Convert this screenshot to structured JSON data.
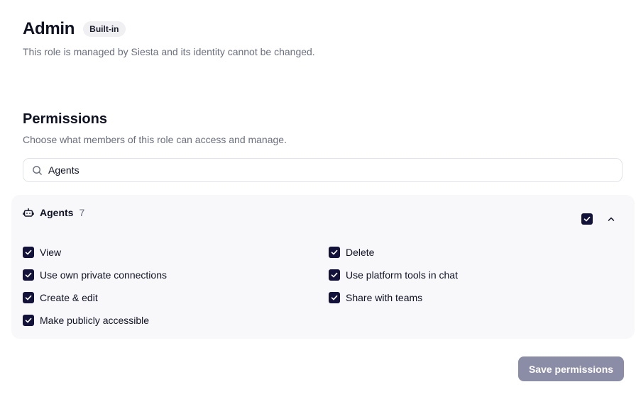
{
  "role": {
    "title": "Admin",
    "badge": "Built-in",
    "description": "This role is managed by Siesta and its identity cannot be changed."
  },
  "permissions": {
    "title": "Permissions",
    "description": "Choose what members of this role can access and manage."
  },
  "search": {
    "value": "Agents",
    "icon": "search-icon"
  },
  "group": {
    "icon": "robot-icon",
    "name": "Agents",
    "count": "7",
    "all_checked": true,
    "collapse_icon": "chevron-up-icon",
    "items": [
      {
        "label": "View",
        "checked": true
      },
      {
        "label": "Delete",
        "checked": true
      },
      {
        "label": "Use own private connections",
        "checked": true
      },
      {
        "label": "Use platform tools in chat",
        "checked": true
      },
      {
        "label": "Create & edit",
        "checked": true
      },
      {
        "label": "Share with teams",
        "checked": true
      },
      {
        "label": "Make publicly accessible",
        "checked": true
      }
    ]
  },
  "actions": {
    "save_label": "Save permissions"
  },
  "colors": {
    "checkbox": "#12123a",
    "save_button": "#8b8ca6",
    "group_background": "#f8f8fa",
    "muted_text": "#6b6f7e"
  }
}
